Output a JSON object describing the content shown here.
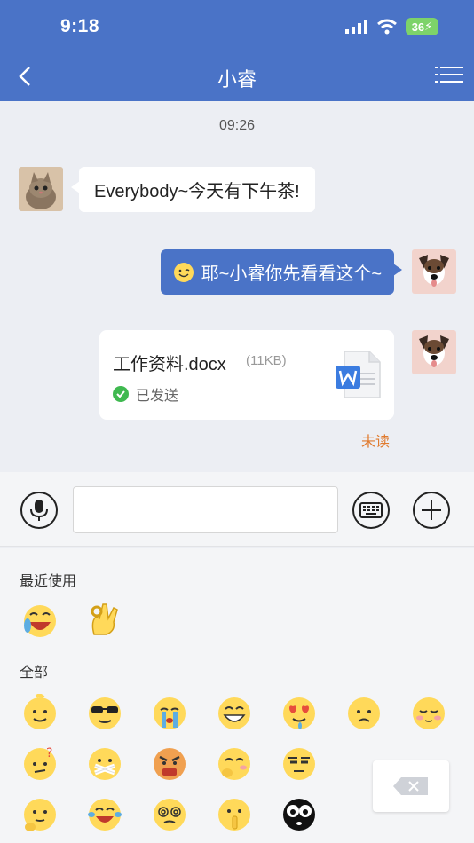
{
  "status_bar": {
    "time": "9:18",
    "battery": "36"
  },
  "nav": {
    "title": "小睿",
    "back_icon": "chevron-left-icon",
    "menu_icon": "list-menu-icon"
  },
  "chat": {
    "timestamp": "09:26",
    "messages": [
      {
        "direction": "in",
        "text": "Everybody~今天有下午茶!"
      },
      {
        "direction": "out",
        "emoji": "smile-emoji",
        "text": "耶~小睿你先看看这个~"
      }
    ],
    "file": {
      "name": "工作资料.docx",
      "size": "(11KB)",
      "status": "已发送"
    },
    "unread_label": "未读"
  },
  "emoji_panel": {
    "recent_label": "最近使用",
    "all_label": "全部"
  },
  "colors": {
    "accent": "#4a73c7",
    "unread": "#e07a2e",
    "sent": "#3fb950"
  }
}
